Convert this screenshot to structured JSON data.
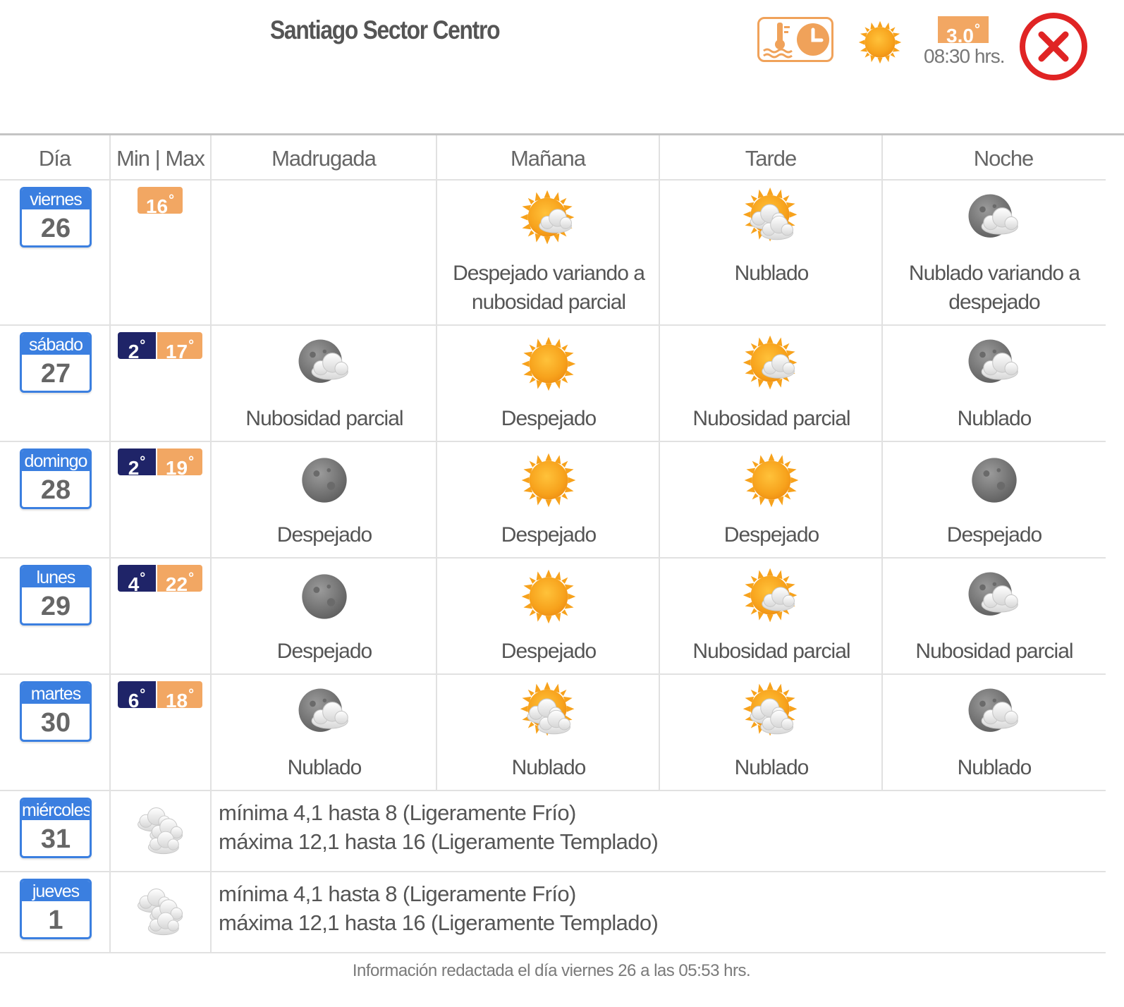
{
  "header": {
    "title": "Santiago Sector Centro",
    "current_temp": "3.0",
    "degree_symbol": "°",
    "observation_time": "08:30 hrs.",
    "icons": [
      "thermometer-clock-icon",
      "sun-icon",
      "close-icon"
    ],
    "accent_colors": {
      "orange": "#f2a763",
      "navy": "#1f2468",
      "blue": "#3b7fe0",
      "close_red": "#e02424"
    }
  },
  "columns": [
    "Día",
    "Min | Max",
    "Madrugada",
    "Mañana",
    "Tarde",
    "Noche"
  ],
  "days": [
    {
      "day": "viernes",
      "date": "26",
      "min": "",
      "max": "16",
      "periods": [
        null,
        {
          "icon": "sun-cloud-icon",
          "label": "Despejado variando a nubosidad parcial"
        },
        {
          "icon": "sun-clouds-icon",
          "label": "Nublado"
        },
        {
          "icon": "moon-cloud-icon",
          "label": "Nublado variando a despejado"
        }
      ]
    },
    {
      "day": "sábado",
      "date": "27",
      "min": "2",
      "max": "17",
      "periods": [
        {
          "icon": "moon-cloud-icon",
          "label": "Nubosidad parcial"
        },
        {
          "icon": "sun-icon",
          "label": "Despejado"
        },
        {
          "icon": "sun-cloud-icon",
          "label": "Nubosidad parcial"
        },
        {
          "icon": "moon-cloud-icon",
          "label": "Nublado"
        }
      ]
    },
    {
      "day": "domingo",
      "date": "28",
      "min": "2",
      "max": "19",
      "periods": [
        {
          "icon": "moon-icon",
          "label": "Despejado"
        },
        {
          "icon": "sun-icon",
          "label": "Despejado"
        },
        {
          "icon": "sun-icon",
          "label": "Despejado"
        },
        {
          "icon": "moon-icon",
          "label": "Despejado"
        }
      ]
    },
    {
      "day": "lunes",
      "date": "29",
      "min": "4",
      "max": "22",
      "periods": [
        {
          "icon": "moon-icon",
          "label": "Despejado"
        },
        {
          "icon": "sun-icon",
          "label": "Despejado"
        },
        {
          "icon": "sun-cloud-icon",
          "label": "Nubosidad parcial"
        },
        {
          "icon": "moon-cloud-icon",
          "label": "Nubosidad parcial"
        }
      ]
    },
    {
      "day": "martes",
      "date": "30",
      "min": "6",
      "max": "18",
      "periods": [
        {
          "icon": "moon-cloud-icon",
          "label": "Nublado"
        },
        {
          "icon": "sun-clouds-icon",
          "label": "Nublado"
        },
        {
          "icon": "sun-clouds-icon",
          "label": "Nublado"
        },
        {
          "icon": "moon-cloud-icon",
          "label": "Nublado"
        }
      ]
    }
  ],
  "extended": [
    {
      "day": "miércoles",
      "date": "31",
      "icon": "clouds-icon",
      "lines": [
        "mínima 4,1 hasta 8 (Ligeramente Frío)",
        "máxima 12,1 hasta 16 (Ligeramente Templado)"
      ]
    },
    {
      "day": "jueves",
      "date": "1",
      "icon": "clouds-icon",
      "lines": [
        "mínima 4,1 hasta 8 (Ligeramente Frío)",
        "máxima 12,1 hasta 16 (Ligeramente Templado)"
      ]
    }
  ],
  "footer": "Información redactada el día viernes 26 a las 05:53 hrs."
}
